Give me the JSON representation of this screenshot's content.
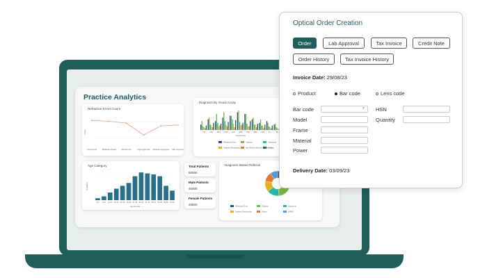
{
  "dashboard": {
    "title": "Practice Analytics",
    "refractive_card": {
      "title": "Refractive Errors Count"
    },
    "visual_card": {
      "title": "Diagnosis By Visual Acuity"
    },
    "age_card": {
      "title": "Age Category"
    },
    "referral_card": {
      "title": "Diagnosis Based Referral"
    },
    "stats": [
      {
        "label": "Total Patients",
        "value": "60000"
      },
      {
        "label": "Male Patients",
        "value": "46000"
      },
      {
        "label": "Female Patients",
        "value": "20800"
      }
    ]
  },
  "form": {
    "title": "Optical Order Creation",
    "tabs_row1": [
      {
        "label": "Order",
        "active": true
      },
      {
        "label": "Lab Approval",
        "active": false
      },
      {
        "label": "Tax Invoice",
        "active": false
      },
      {
        "label": "Credit Note",
        "active": false
      }
    ],
    "tabs_row2": [
      {
        "label": "Order History"
      },
      {
        "label": "Tax Invoice History"
      }
    ],
    "invoice_date_label": "Invoice Date:",
    "invoice_date": "29/08/23",
    "radio_options": [
      {
        "label": "Product",
        "selected": false
      },
      {
        "label": "Bar code",
        "selected": true
      },
      {
        "label": "Lens code",
        "selected": false
      }
    ],
    "fields_left": [
      "Bar code",
      "Model",
      "Frame",
      "Material",
      "Power"
    ],
    "fields_right": [
      "HSN",
      "Quantity"
    ],
    "delivery_date_label": "Delivery Date:",
    "delivery_date": "03/09/23"
  },
  "chart_data": [
    {
      "type": "line",
      "title": "Refractive Errors Count",
      "xlabel": "",
      "ylabel": "Count",
      "categories": [
        "Low Myopia",
        "Moderate Myopia",
        "Mild Myopia",
        "High Hyperopia",
        "Moderate Hyperopia",
        "Mild Hyperopia"
      ],
      "values": [
        28,
        27,
        25,
        12,
        22,
        23
      ],
      "ylim": [
        0,
        35
      ],
      "color": "#e8a38c"
    },
    {
      "type": "bar",
      "title": "Diagnosis By Visual Acuity",
      "xlabel": "Visual Acuity",
      "categories": [
        "6/6",
        "6/9",
        "6/12",
        "6/18",
        "6/24",
        "6/36",
        "6/60",
        "3/60",
        "1/60",
        "PL+",
        "PL-"
      ],
      "series": [
        {
          "name": "Refractive Error",
          "color": "#2a4d7a",
          "values": [
            6,
            12,
            10,
            14,
            16,
            20,
            18,
            12,
            8,
            10,
            6
          ]
        },
        {
          "name": "Cataract",
          "color": "#7ab648",
          "values": [
            10,
            14,
            18,
            20,
            16,
            22,
            18,
            14,
            12,
            8,
            7
          ]
        },
        {
          "name": "Glaucoma",
          "color": "#2bb5a8",
          "values": [
            4,
            6,
            8,
            10,
            12,
            9,
            7,
            6,
            5,
            4,
            3
          ]
        },
        {
          "name": "Diabetic Retinopathy",
          "color": "#e8b21e",
          "values": [
            3,
            5,
            4,
            6,
            7,
            5,
            4,
            6,
            5,
            3,
            2
          ]
        },
        {
          "name": "Age Related Macular Degeneration",
          "color": "#e07b30",
          "values": [
            2,
            3,
            5,
            4,
            3,
            6,
            4,
            3,
            2,
            2,
            1
          ]
        },
        {
          "name": "Others",
          "color": "#1f5e5b",
          "values": [
            5,
            8,
            7,
            9,
            11,
            8,
            10,
            7,
            6,
            5,
            4
          ]
        }
      ],
      "ylim": [
        0,
        25
      ]
    },
    {
      "type": "bar",
      "title": "Age Category",
      "xlabel": "Age Pounds",
      "ylabel": "% patients",
      "categories": [
        "0-5",
        "6-10",
        "11-15",
        "16-20",
        "21-25",
        "26-30",
        "31-35",
        "36-40",
        "41-45",
        "46-50",
        "51-55",
        "56-60",
        "61-65"
      ],
      "values": [
        2,
        4,
        8,
        12,
        15,
        18,
        25,
        29,
        28,
        27,
        25,
        15,
        10
      ],
      "color": "#2a6f8a",
      "ylim": [
        0,
        32
      ]
    },
    {
      "type": "pie",
      "title": "Diagnosis Based Referral",
      "categories": [
        "Refractive Error",
        "Cataract",
        "Glaucoma",
        "Diabetic Retinopathy",
        "Others",
        "ARMD"
      ],
      "values": [
        30,
        18,
        16,
        14,
        12,
        10
      ],
      "colors": [
        "#2a4d7a",
        "#7ab648",
        "#2bb5a8",
        "#e8b21e",
        "#e07b30",
        "#5b9bd5"
      ]
    }
  ]
}
